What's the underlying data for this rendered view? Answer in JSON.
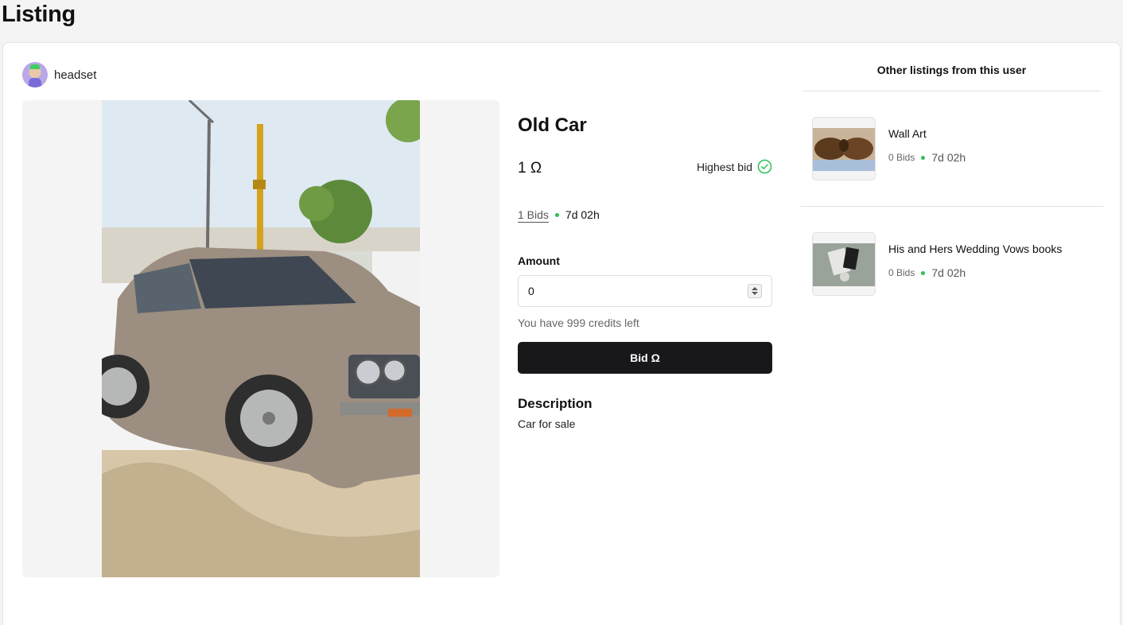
{
  "page": {
    "title": "Listing"
  },
  "seller": {
    "name": "headset"
  },
  "listing": {
    "title": "Old Car",
    "price": "1 Ω",
    "highest_bid_label": "Highest bid",
    "bids": "1 Bids",
    "time_left": "7d 02h",
    "amount_label": "Amount",
    "amount_value": "0",
    "credits_text": "You have 999 credits left",
    "bid_button": "Bid Ω",
    "description_heading": "Description",
    "description": "Car for sale"
  },
  "sidebar": {
    "title": "Other listings from this user",
    "items": [
      {
        "title": "Wall Art",
        "bids": "0 Bids",
        "time": "7d 02h"
      },
      {
        "title": "His and Hers Wedding Vows books",
        "bids": "0 Bids",
        "time": "7d 02h"
      }
    ]
  },
  "colors": {
    "accent": "#2fbf5a",
    "button": "#18181b"
  }
}
